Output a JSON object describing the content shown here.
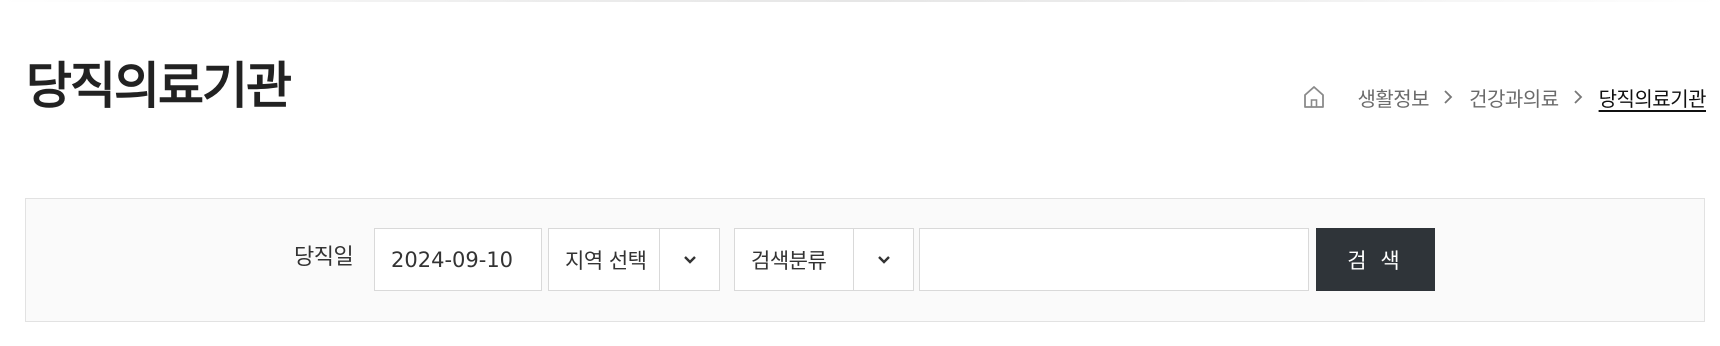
{
  "page": {
    "title": "당직의료기관"
  },
  "breadcrumb": {
    "home_icon": "home-icon",
    "items": [
      "생활정보",
      "건강과의료",
      "당직의료기관"
    ]
  },
  "search": {
    "label": "당직일",
    "date_value": "2024-09-10",
    "region_select": {
      "selected": "지역 선택"
    },
    "category_select": {
      "selected": "검색분류"
    },
    "keyword_value": "",
    "button_label": "검 색"
  },
  "colors": {
    "button_bg": "#2f3439",
    "panel_bg": "#fafafa",
    "border": "#d9d9d9"
  }
}
